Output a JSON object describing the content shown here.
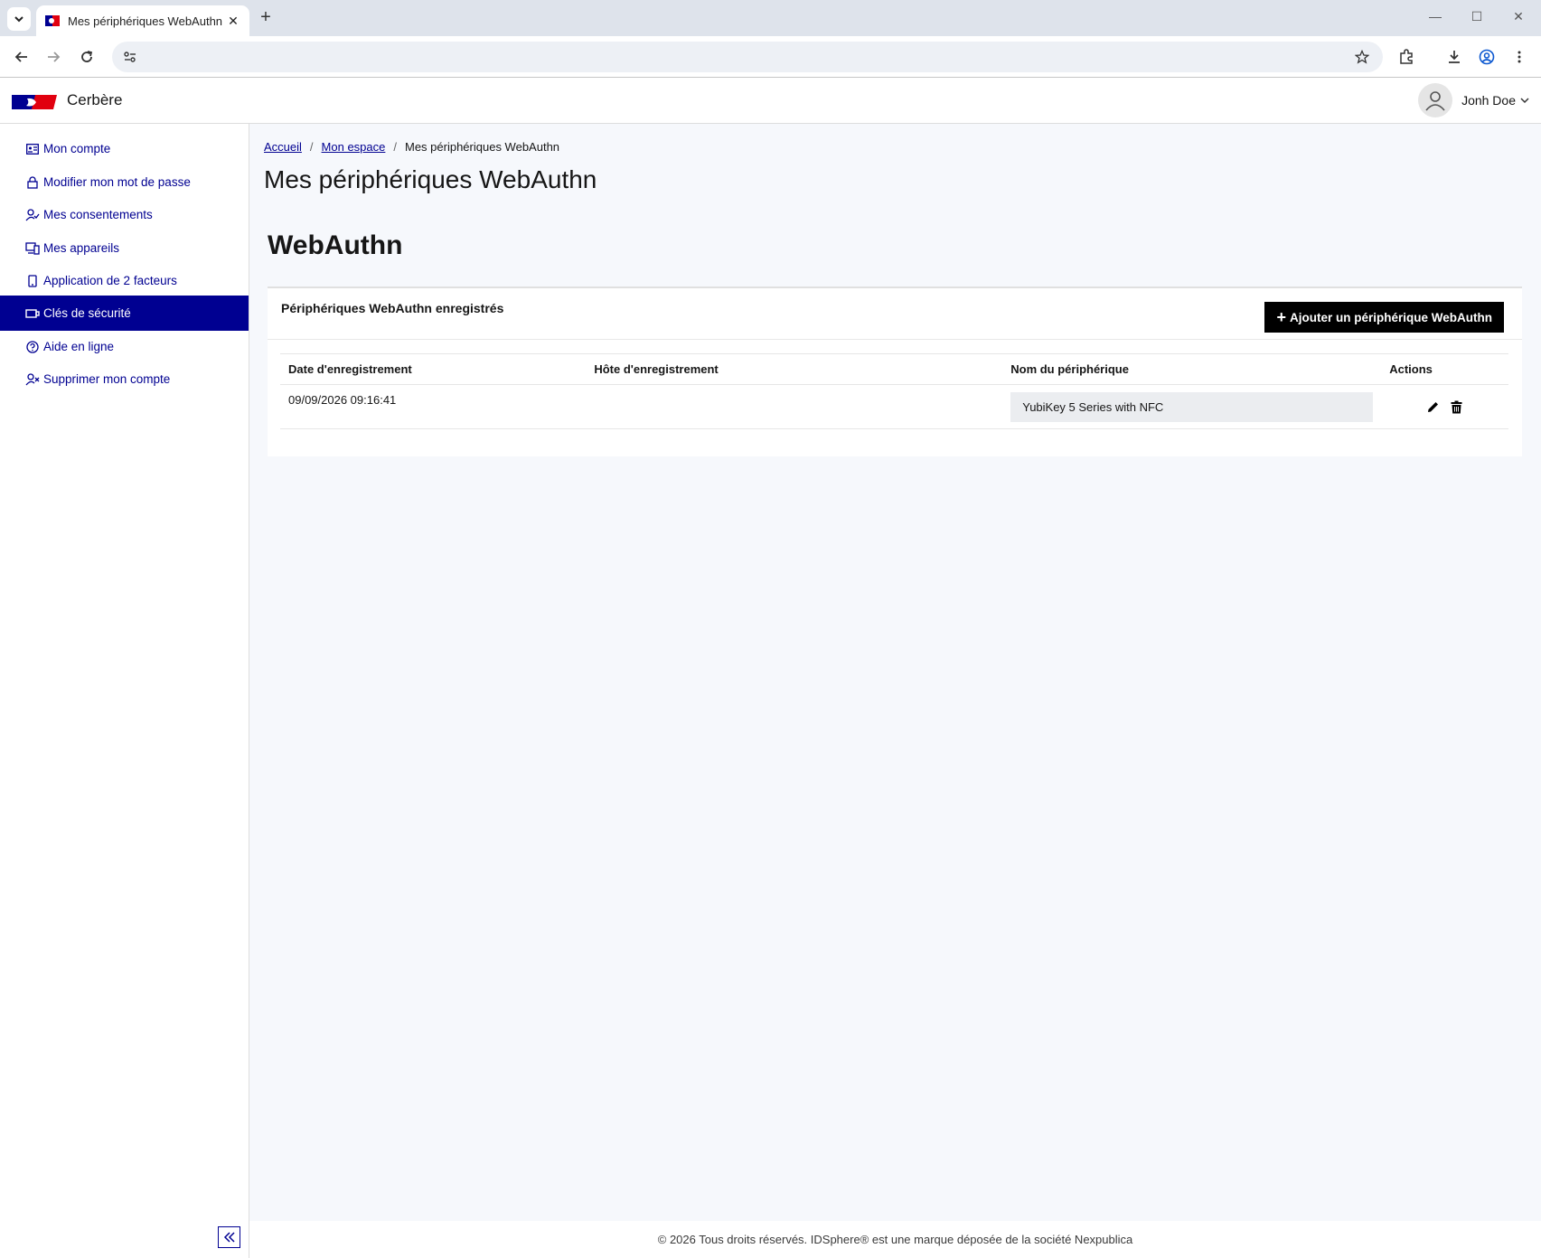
{
  "browser": {
    "tab_title": "Mes périphériques WebAuthn - ",
    "close_glyph": "✕",
    "new_tab_glyph": "+",
    "minimize_glyph": "—",
    "maximize_glyph": "☐",
    "window_close_glyph": "✕"
  },
  "header": {
    "app_name": "Cerbère",
    "user_name": "Jonh Doe"
  },
  "sidebar": {
    "items": [
      {
        "label": "Mon compte",
        "icon": "id-card-icon"
      },
      {
        "label": "Modifier mon mot de passe",
        "icon": "lock-icon"
      },
      {
        "label": "Mes consentements",
        "icon": "user-check-icon"
      },
      {
        "label": "Mes appareils",
        "icon": "devices-icon"
      },
      {
        "label": "Application de 2 facteurs",
        "icon": "phone-icon"
      },
      {
        "label": "Clés de sécurité",
        "icon": "security-key-icon",
        "active": true
      },
      {
        "label": "Aide en ligne",
        "icon": "help-icon"
      },
      {
        "label": "Supprimer mon compte",
        "icon": "user-delete-icon"
      }
    ]
  },
  "breadcrumb": {
    "home": "Accueil",
    "space": "Mon espace",
    "current": "Mes périphériques WebAuthn",
    "separator": "/"
  },
  "page": {
    "title": "Mes périphériques WebAuthn",
    "section_title": "WebAuthn"
  },
  "card": {
    "title": "Périphériques WebAuthn enregistrés",
    "add_button_icon": "+",
    "add_button_label": "Ajouter un périphérique WebAuthn"
  },
  "table": {
    "headers": [
      "Date d'enregistrement",
      "Hôte d'enregistrement",
      "Nom du périphérique",
      "Actions"
    ],
    "rows": [
      {
        "date": "09/09/2026 09:16:41",
        "host": "",
        "device_name": "YubiKey 5 Series with NFC"
      }
    ]
  },
  "footer": {
    "text": "© 2026 Tous droits réservés. IDSphere® est une marque déposée de la société Nexpublica"
  },
  "colors": {
    "accent": "#000091",
    "page_background": "#f6f8fc",
    "button_black": "#000000",
    "marianne_red": "#e1000f"
  }
}
